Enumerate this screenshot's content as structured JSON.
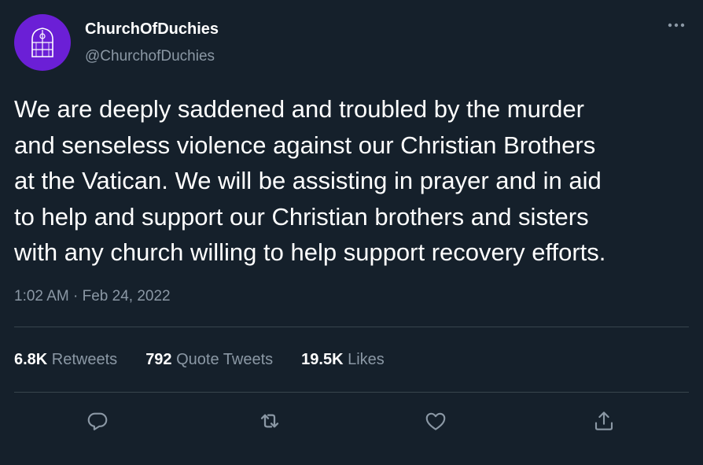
{
  "author": {
    "display_name": "ChurchOfDuchies",
    "handle": "@ChurchofDuchies",
    "avatar_icon": "church-window-icon",
    "avatar_color": "#6b1fd6"
  },
  "tweet": {
    "text": "We are deeply saddened and troubled by the murder\nand senseless violence against our Christian Brothers\nat the Vatican. We will be assisting in prayer and in aid\nto help and support our Christian brothers and sisters\nwith any church willing to help support recovery efforts.",
    "time": "1:02 AM",
    "separator": " · ",
    "date": "Feb 24, 2022"
  },
  "stats": {
    "retweets": {
      "count": "6.8K",
      "label": " Retweets"
    },
    "quote_tweets": {
      "count": "792",
      "label": " Quote Tweets"
    },
    "likes": {
      "count": "19.5K",
      "label": " Likes"
    }
  },
  "actions": {
    "reply_icon": "reply-icon",
    "retweet_icon": "retweet-icon",
    "like_icon": "heart-icon",
    "share_icon": "share-icon"
  },
  "colors": {
    "background": "#15202b",
    "secondary_text": "#8b98a5",
    "divider": "#38444d"
  }
}
